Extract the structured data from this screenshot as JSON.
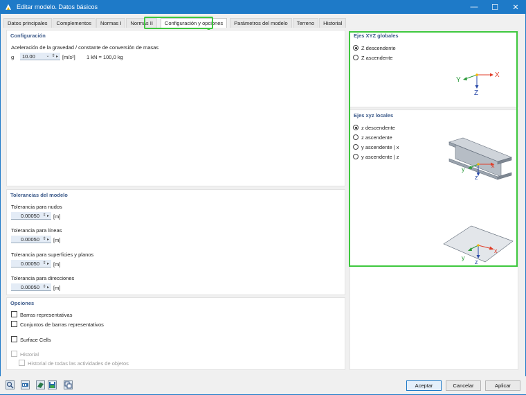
{
  "window": {
    "title": "Editar modelo. Datos básicos",
    "minimize": "—",
    "maximize": "☐",
    "close": "✕"
  },
  "tabs": [
    {
      "label": "Datos principales"
    },
    {
      "label": "Complementos"
    },
    {
      "label": "Normas I"
    },
    {
      "label": "Normas II"
    },
    {
      "label": "Configuración y opciones"
    },
    {
      "label": "Parámetros del modelo"
    },
    {
      "label": "Terreno"
    },
    {
      "label": "Historial"
    }
  ],
  "config": {
    "title": "Configuración",
    "gravity_label": "Aceleración de la gravedad / constante de conversión de masas",
    "g_symbol": "g",
    "g_value": "10.00",
    "g_unit": "[m/s²]",
    "g_note": "1 kN = 100,0 kg"
  },
  "tolerances": {
    "title": "Tolerancias del modelo",
    "items": [
      {
        "label": "Tolerancia para nudos",
        "value": "0.00050",
        "unit": "[m]"
      },
      {
        "label": "Tolerancia para líneas",
        "value": "0.00050",
        "unit": "[m]"
      },
      {
        "label": "Tolerancia para superficies y planos",
        "value": "0.00050",
        "unit": "[m]"
      },
      {
        "label": "Tolerancia para direcciones",
        "value": "0.00050",
        "unit": "[m]"
      }
    ]
  },
  "options": {
    "title": "Opciones",
    "items": [
      {
        "label": "Barras representativas"
      },
      {
        "label": "Conjuntos de barras representativos"
      },
      {
        "label": "Surface Cells"
      },
      {
        "label": "Historial"
      },
      {
        "label": "Historial de todas las actividades de objetos"
      }
    ]
  },
  "global_axes": {
    "title": "Ejes XYZ globales",
    "options": [
      {
        "label": "Z descendente",
        "selected": true
      },
      {
        "label": "Z ascendente",
        "selected": false
      }
    ],
    "axis_x": "X",
    "axis_y": "Y",
    "axis_z": "Z"
  },
  "local_axes": {
    "title": "Ejes xyz locales",
    "options": [
      {
        "label": "z descendente",
        "selected": true
      },
      {
        "label": "z ascendente",
        "selected": false
      },
      {
        "label": "y ascendente | x",
        "selected": false
      },
      {
        "label": "y ascendente | z",
        "selected": false
      }
    ],
    "axis_x": "x",
    "axis_y": "y",
    "axis_z": "z"
  },
  "buttons": {
    "ok": "Aceptar",
    "cancel": "Cancelar",
    "apply": "Aplicar"
  },
  "colors": {
    "accent": "#1e7ac8",
    "highlight": "#3ec83e",
    "section_title": "#3c5a8a",
    "axis_x": "#e03c28",
    "axis_y": "#2a9a3a",
    "axis_z": "#2a4aa8"
  }
}
